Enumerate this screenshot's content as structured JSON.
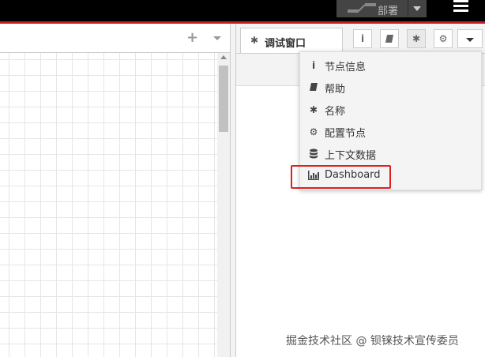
{
  "header": {
    "deploy_label": "部署",
    "menu_icon": "hamburger-menu-icon",
    "accent_color": "#c02020"
  },
  "workspace": {
    "add_icon_text": "+"
  },
  "sidebar": {
    "active_tab": {
      "icon": "bug-icon",
      "label": "调试窗口"
    },
    "buttons": [
      {
        "name": "info",
        "glyph": "i"
      },
      {
        "name": "help",
        "glyph": "book"
      },
      {
        "name": "debug",
        "glyph": "bug",
        "active": true
      },
      {
        "name": "config",
        "glyph": "gear"
      }
    ]
  },
  "dropdown": {
    "items": [
      {
        "icon": "info-icon",
        "label": "节点信息"
      },
      {
        "icon": "book-icon",
        "label": "帮助"
      },
      {
        "icon": "bug-icon",
        "label": "名称"
      },
      {
        "icon": "gear-icon",
        "label": "配置节点"
      },
      {
        "icon": "database-icon",
        "label": "上下文数据"
      },
      {
        "icon": "bar-chart-icon",
        "label": "Dashboard"
      }
    ],
    "highlight_color": "#e02020"
  },
  "watermark": "掘金技术社区 @ 钡铼技术宣传委员"
}
